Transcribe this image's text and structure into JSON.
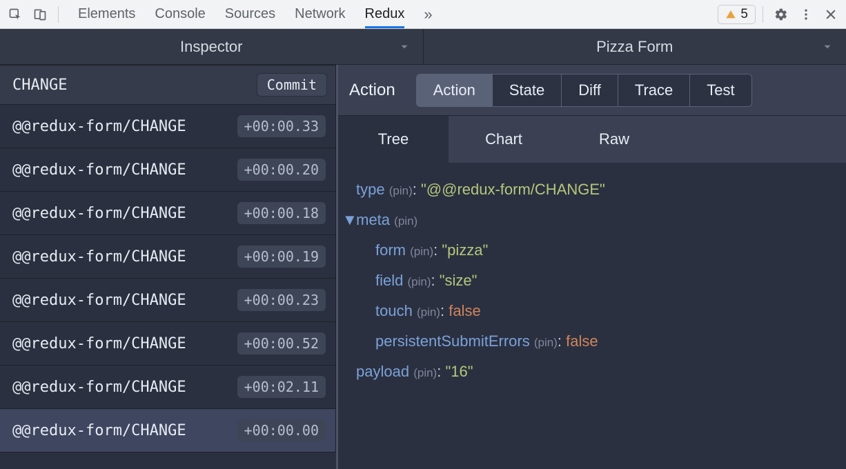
{
  "devtools": {
    "tabs": [
      "Elements",
      "Console",
      "Sources",
      "Network",
      "Redux"
    ],
    "active_tab": "Redux",
    "warning_count": "5"
  },
  "redux": {
    "header": {
      "left": "Inspector",
      "right": "Pizza Form"
    },
    "filter_value": "CHANGE",
    "commit_label": "Commit",
    "actions": [
      {
        "name": "@@redux-form/CHANGE",
        "time": "+00:00.33"
      },
      {
        "name": "@@redux-form/CHANGE",
        "time": "+00:00.20"
      },
      {
        "name": "@@redux-form/CHANGE",
        "time": "+00:00.18"
      },
      {
        "name": "@@redux-form/CHANGE",
        "time": "+00:00.19"
      },
      {
        "name": "@@redux-form/CHANGE",
        "time": "+00:00.23"
      },
      {
        "name": "@@redux-form/CHANGE",
        "time": "+00:00.52"
      },
      {
        "name": "@@redux-form/CHANGE",
        "time": "+00:02.11"
      },
      {
        "name": "@@redux-form/CHANGE",
        "time": "+00:00.00"
      }
    ],
    "selected_action_index": 7,
    "inspector": {
      "section_label": "Action",
      "tabs": [
        "Action",
        "State",
        "Diff",
        "Trace",
        "Test"
      ],
      "active_tab": "Action",
      "view_tabs": [
        "Tree",
        "Chart",
        "Raw"
      ],
      "active_view": "Tree",
      "pin_label": "(pin)",
      "tree": {
        "type_key": "type",
        "type_value": "\"@@redux-form/CHANGE\"",
        "meta_key": "meta",
        "meta_children": [
          {
            "key": "form",
            "value": "\"pizza\"",
            "kind": "str"
          },
          {
            "key": "field",
            "value": "\"size\"",
            "kind": "str"
          },
          {
            "key": "touch",
            "value": "false",
            "kind": "bool"
          },
          {
            "key": "persistentSubmitErrors",
            "value": "false",
            "kind": "bool"
          }
        ],
        "payload_key": "payload",
        "payload_value": "\"16\""
      }
    }
  }
}
